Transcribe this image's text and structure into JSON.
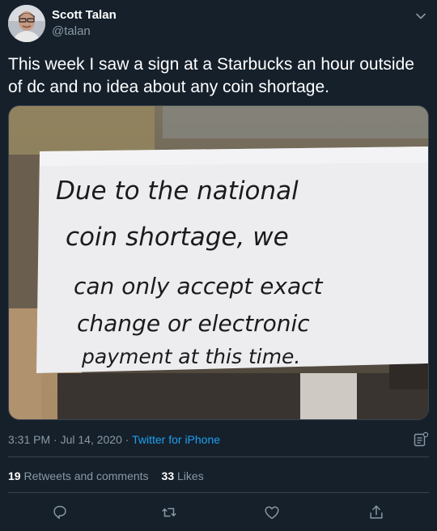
{
  "author": {
    "name": "Scott Talan",
    "handle": "@talan"
  },
  "tweet": {
    "text": "This week I saw a sign at a Starbucks an hour outside of dc and no idea about  any coin shortage."
  },
  "media": {
    "sign_lines": [
      "Due to the national",
      "coin shortage, we",
      "can only accept exact",
      "change or electronic",
      "payment at this time."
    ]
  },
  "meta": {
    "time": "3:31 PM",
    "separator": "·",
    "date": "Jul 14, 2020",
    "source": "Twitter for iPhone"
  },
  "stats": {
    "retweets_count": "19",
    "retweets_label": "Retweets and comments",
    "likes_count": "33",
    "likes_label": "Likes"
  },
  "icons": {
    "caret": "chevron-down-icon",
    "analytics": "analytics-icon",
    "reply": "reply-icon",
    "retweet": "retweet-icon",
    "like": "heart-icon",
    "share": "share-icon"
  },
  "colors": {
    "background": "#15202b",
    "secondary_text": "#8899a6",
    "link": "#1da1f2",
    "divider": "#38444d"
  }
}
